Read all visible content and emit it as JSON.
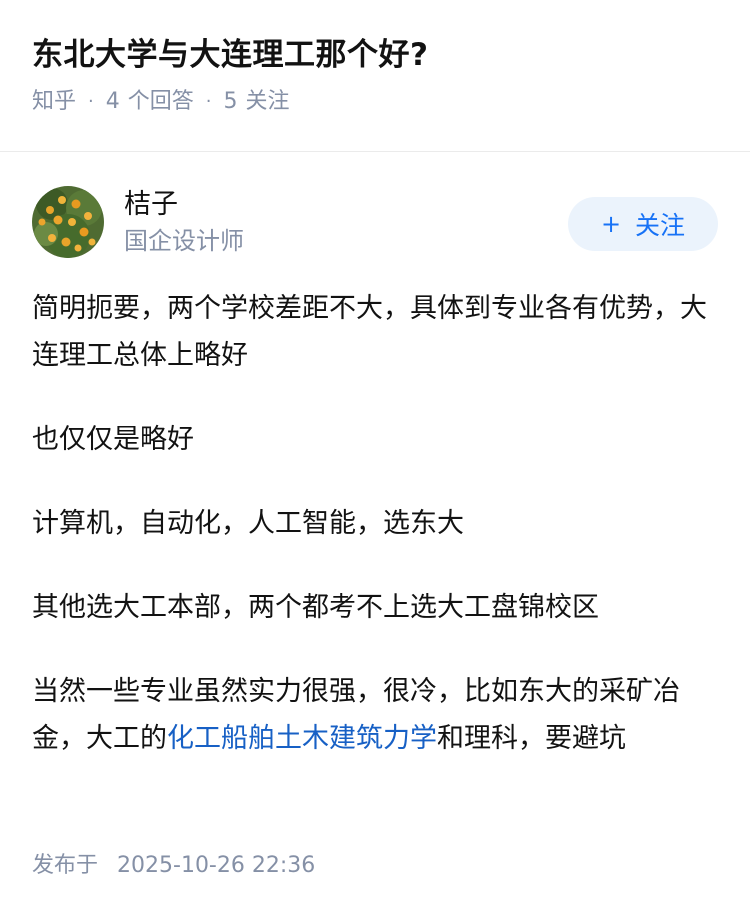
{
  "question": {
    "title": "东北大学与大连理工那个好?",
    "source": "知乎",
    "answers_count": "4",
    "answers_label": "个回答",
    "follows_count": "5",
    "follows_label": "关注",
    "meta_separator": "·"
  },
  "answer": {
    "author": {
      "name": "桔子",
      "headline": "国企设计师",
      "avatar_icon": "orange-tree-avatar"
    },
    "follow_button": {
      "plus": "+",
      "label": "关注"
    },
    "paragraphs": [
      "简明扼要，两个学校差距不大，具体到专业各有优势，大连理工总体上略好",
      "也仅仅是略好",
      "计算机，自动化，人工智能，选东大",
      "其他选大工本部，两个都考不上选大工盘锦校区"
    ],
    "last_paragraph": {
      "before": "当然一些专业虽然实力很强，很冷，比如东大的采矿冶金，大工的",
      "link": "化工船舶土木建筑力学",
      "after": "和理科，要避坑"
    },
    "publish": {
      "label": "发布于",
      "datetime": "2025-10-26 22:36"
    }
  },
  "colors": {
    "title": "#121212",
    "meta": "#8590a6",
    "follow_bg": "#ebf3fc",
    "follow_text": "#1772f6",
    "link": "#1760c5"
  }
}
